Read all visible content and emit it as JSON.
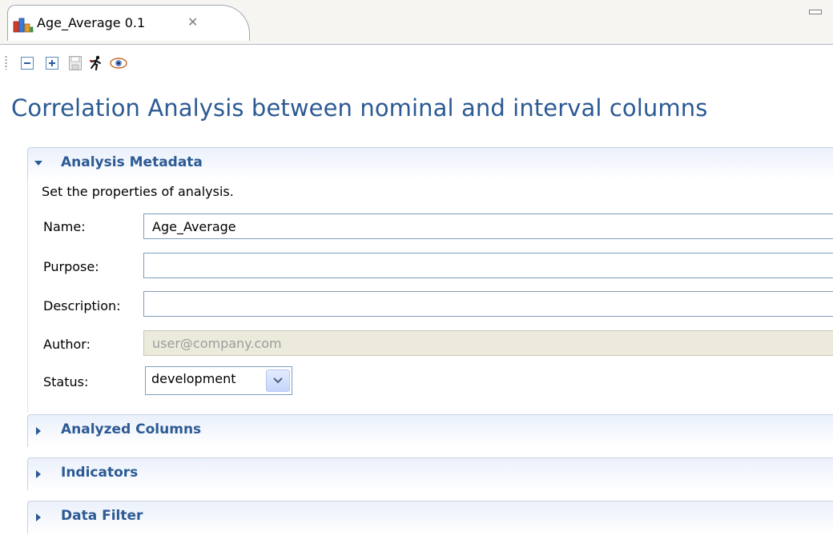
{
  "tab": {
    "title": "Age_Average 0.1",
    "icon": "bar-chart-icon",
    "close_glyph": "✕"
  },
  "toolbar": {
    "items": [
      "collapse-all-icon",
      "expand-all-icon",
      "save-icon",
      "run-icon",
      "refresh-preview-icon"
    ]
  },
  "page_title": "Correlation Analysis between nominal and interval columns",
  "metadata": {
    "title": "Analysis Metadata",
    "description": "Set the properties of analysis.",
    "fields": {
      "name_label": "Name:",
      "name_value": "Age_Average",
      "purpose_label": "Purpose:",
      "purpose_value": "",
      "description_label": "Description:",
      "description_value": "",
      "author_label": "Author:",
      "author_value": "user@company.com",
      "status_label": "Status:",
      "status_value": "development"
    }
  },
  "sections": {
    "analyzed_columns": "Analyzed Columns",
    "indicators": "Indicators",
    "data_filter": "Data Filter"
  },
  "colors": {
    "title": "#2c5a94",
    "section_title": "#2c5a94",
    "disabled_field": "#ebeadb"
  }
}
